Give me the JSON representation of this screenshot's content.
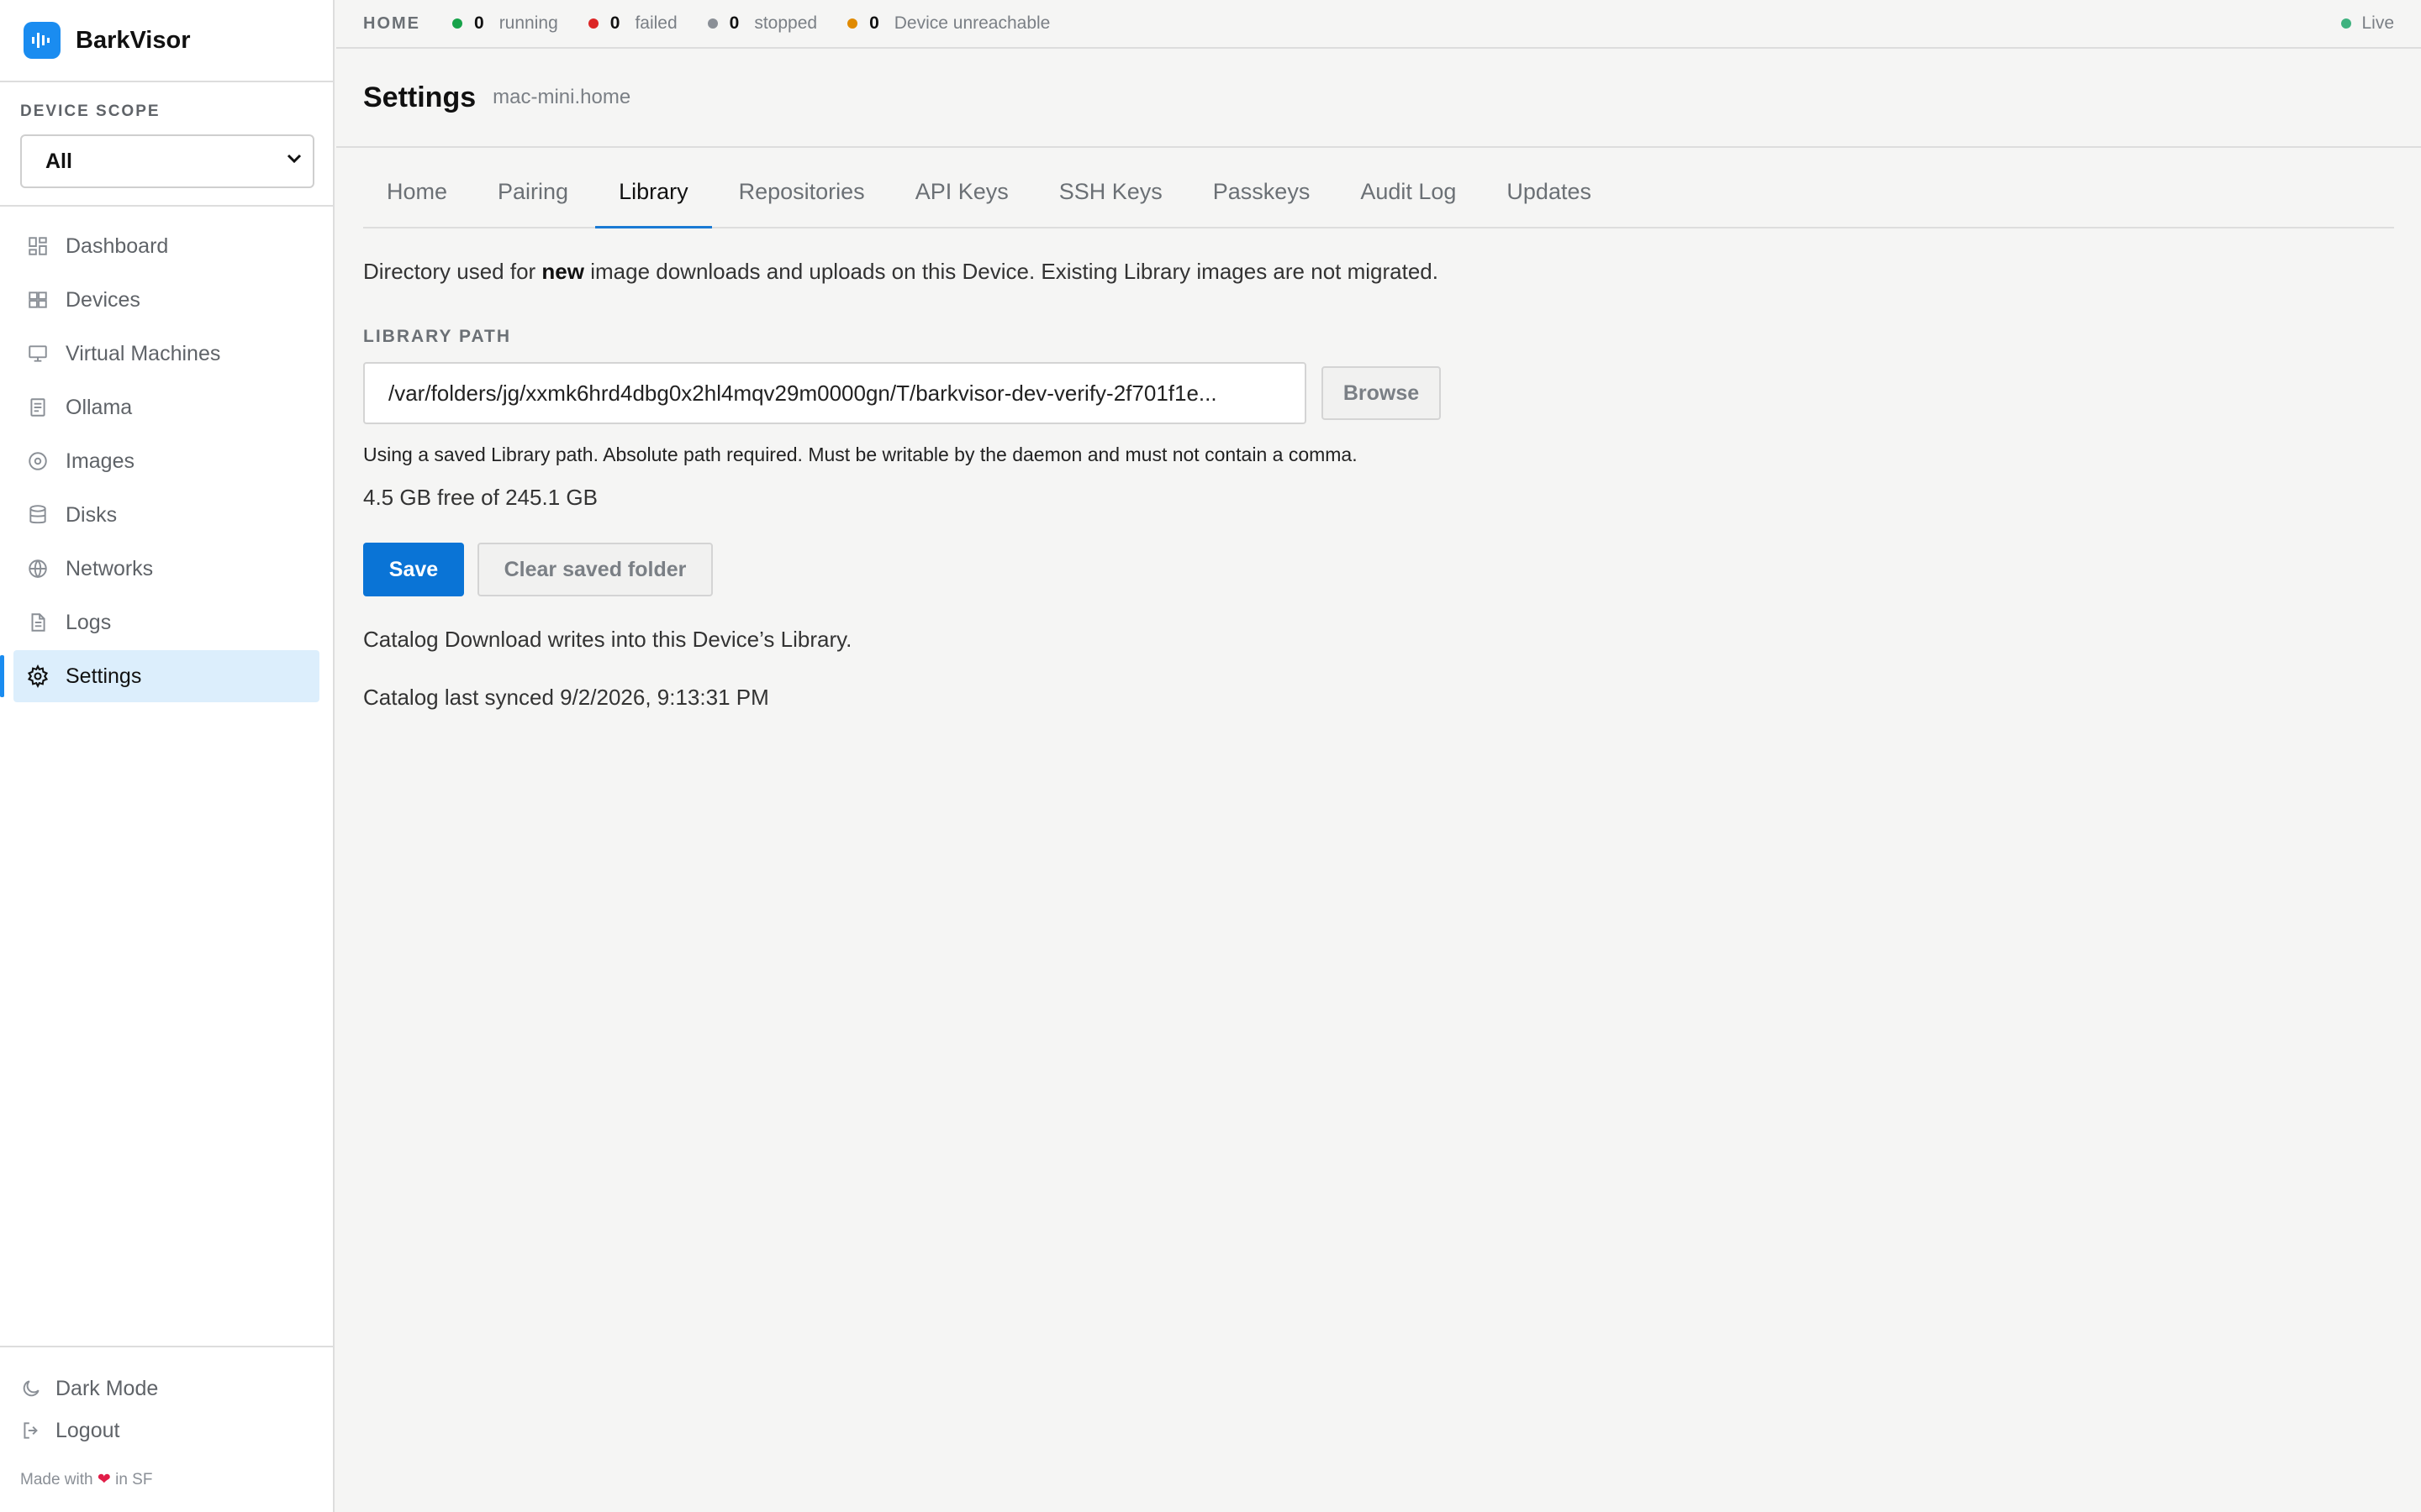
{
  "brand": {
    "name": "BarkVisor",
    "logo_icon": "waveform-icon",
    "accent": "#1a8cf0"
  },
  "sidebar": {
    "scope_label": "DEVICE SCOPE",
    "scope_value": "All",
    "items": [
      {
        "label": "Dashboard",
        "icon": "dashboard-icon"
      },
      {
        "label": "Devices",
        "icon": "devices-icon"
      },
      {
        "label": "Virtual Machines",
        "icon": "monitor-icon"
      },
      {
        "label": "Ollama",
        "icon": "document-icon"
      },
      {
        "label": "Images",
        "icon": "disc-icon"
      },
      {
        "label": "Disks",
        "icon": "database-icon"
      },
      {
        "label": "Networks",
        "icon": "globe-icon"
      },
      {
        "label": "Logs",
        "icon": "file-icon"
      },
      {
        "label": "Settings",
        "icon": "gear-icon",
        "active": true
      }
    ],
    "dark_mode": "Dark Mode",
    "logout": "Logout",
    "made_with_prefix": "Made with",
    "made_with_suffix": "in SF"
  },
  "topbar": {
    "crumb": "HOME",
    "stats": [
      {
        "count": "0",
        "label": "running",
        "color": "#17a34a"
      },
      {
        "count": "0",
        "label": "failed",
        "color": "#dc2626"
      },
      {
        "count": "0",
        "label": "stopped",
        "color": "#8a8f96"
      },
      {
        "count": "0",
        "label": "Device unreachable",
        "color": "#e08a00"
      }
    ],
    "live": "Live",
    "live_color": "#3fb27f"
  },
  "header": {
    "title": "Settings",
    "subtitle": "mac-mini.home"
  },
  "tabs": [
    "Home",
    "Pairing",
    "Library",
    "Repositories",
    "API Keys",
    "SSH Keys",
    "Passkeys",
    "Audit Log",
    "Updates"
  ],
  "active_tab": "Library",
  "library": {
    "intro_before": "Directory used for ",
    "intro_bold": "new",
    "intro_after": " image downloads and uploads on this Device. Existing Library images are not migrated.",
    "path_label": "LIBRARY PATH",
    "path_value": "/var/folders/jg/xxmk6hrd4dbg0x2hl4mqv29m0000gn/T/barkvisor-dev-verify-2f701f1e...",
    "browse": "Browse",
    "help": "Using a saved Library path. Absolute path required. Must be writable by the daemon and must not contain a comma.",
    "free": "4.5 GB free of 245.1 GB",
    "save": "Save",
    "clear": "Clear saved folder",
    "catalog_note": "Catalog Download writes into this Device’s Library.",
    "catalog_synced": "Catalog last synced 9/2/2026, 9:13:31 PM"
  }
}
